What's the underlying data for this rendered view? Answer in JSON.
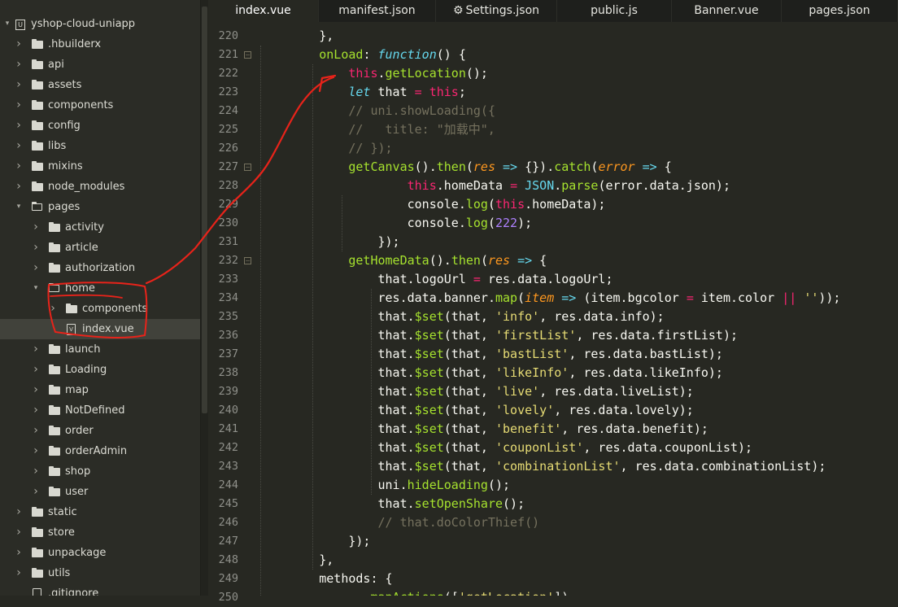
{
  "sidebar": {
    "project": "yshop-cloud-uniapp",
    "items": [
      {
        "label": ".hbuilderx",
        "type": "folder",
        "depth": 1,
        "expanded": false
      },
      {
        "label": "api",
        "type": "folder",
        "depth": 1,
        "expanded": false
      },
      {
        "label": "assets",
        "type": "folder",
        "depth": 1,
        "expanded": false
      },
      {
        "label": "components",
        "type": "folder",
        "depth": 1,
        "expanded": false
      },
      {
        "label": "config",
        "type": "folder",
        "depth": 1,
        "expanded": false
      },
      {
        "label": "libs",
        "type": "folder",
        "depth": 1,
        "expanded": false
      },
      {
        "label": "mixins",
        "type": "folder",
        "depth": 1,
        "expanded": false
      },
      {
        "label": "node_modules",
        "type": "folder",
        "depth": 1,
        "expanded": false
      },
      {
        "label": "pages",
        "type": "folder",
        "depth": 1,
        "expanded": true
      },
      {
        "label": "activity",
        "type": "folder",
        "depth": 2,
        "expanded": false
      },
      {
        "label": "article",
        "type": "folder",
        "depth": 2,
        "expanded": false
      },
      {
        "label": "authorization",
        "type": "folder",
        "depth": 2,
        "expanded": false
      },
      {
        "label": "home",
        "type": "folder",
        "depth": 2,
        "expanded": true
      },
      {
        "label": "components",
        "type": "folder",
        "depth": 3,
        "expanded": false
      },
      {
        "label": "index.vue",
        "type": "file",
        "depth": 3,
        "selected": true,
        "icon_text": "V"
      },
      {
        "label": "launch",
        "type": "folder",
        "depth": 2,
        "expanded": false
      },
      {
        "label": "Loading",
        "type": "folder",
        "depth": 2,
        "expanded": false
      },
      {
        "label": "map",
        "type": "folder",
        "depth": 2,
        "expanded": false
      },
      {
        "label": "NotDefined",
        "type": "folder",
        "depth": 2,
        "expanded": false
      },
      {
        "label": "order",
        "type": "folder",
        "depth": 2,
        "expanded": false
      },
      {
        "label": "orderAdmin",
        "type": "folder",
        "depth": 2,
        "expanded": false
      },
      {
        "label": "shop",
        "type": "folder",
        "depth": 2,
        "expanded": false
      },
      {
        "label": "user",
        "type": "folder",
        "depth": 2,
        "expanded": false
      },
      {
        "label": "static",
        "type": "folder",
        "depth": 1,
        "expanded": false
      },
      {
        "label": "store",
        "type": "folder",
        "depth": 1,
        "expanded": false
      },
      {
        "label": "unpackage",
        "type": "folder",
        "depth": 1,
        "expanded": false
      },
      {
        "label": "utils",
        "type": "folder",
        "depth": 1,
        "expanded": false
      },
      {
        "label": ".gitignore",
        "type": "file",
        "depth": 1,
        "icon_text": ""
      }
    ]
  },
  "tabs": [
    {
      "label": "index.vue",
      "active": true,
      "icon": ""
    },
    {
      "label": "manifest.json",
      "active": false,
      "icon": ""
    },
    {
      "label": "Settings.json",
      "active": false,
      "icon": "gear-icon"
    },
    {
      "label": "public.js",
      "active": false,
      "icon": ""
    },
    {
      "label": "Banner.vue",
      "active": false,
      "icon": ""
    },
    {
      "label": "pages.json",
      "active": false,
      "icon": ""
    }
  ],
  "editor": {
    "lines": [
      {
        "n": "220",
        "fold": false,
        "tokens": [
          [
            "        },",
            "t-plain"
          ]
        ]
      },
      {
        "n": "221",
        "fold": true,
        "tokens": [
          [
            "        ",
            "t-plain"
          ],
          [
            "onLoad",
            "t-fn"
          ],
          [
            ": ",
            "t-plain"
          ],
          [
            "function",
            "t-kw"
          ],
          [
            "() {",
            "t-plain"
          ]
        ]
      },
      {
        "n": "222",
        "fold": false,
        "tokens": [
          [
            "            ",
            "t-plain"
          ],
          [
            "this",
            "t-this"
          ],
          [
            ".",
            "t-plain"
          ],
          [
            "getLocation",
            "t-fn"
          ],
          [
            "();",
            "t-plain"
          ]
        ]
      },
      {
        "n": "223",
        "fold": false,
        "tokens": [
          [
            "            ",
            "t-plain"
          ],
          [
            "let",
            "t-kw"
          ],
          [
            " that ",
            "t-plain"
          ],
          [
            "=",
            "t-op"
          ],
          [
            " ",
            "t-plain"
          ],
          [
            "this",
            "t-this"
          ],
          [
            ";",
            "t-plain"
          ]
        ]
      },
      {
        "n": "224",
        "fold": false,
        "tokens": [
          [
            "            ",
            "t-plain"
          ],
          [
            "// uni.showLoading({",
            "t-cm"
          ]
        ]
      },
      {
        "n": "225",
        "fold": false,
        "tokens": [
          [
            "            ",
            "t-plain"
          ],
          [
            "//   title: \"加载中\",",
            "t-cm"
          ]
        ]
      },
      {
        "n": "226",
        "fold": false,
        "tokens": [
          [
            "            ",
            "t-plain"
          ],
          [
            "// });",
            "t-cm"
          ]
        ]
      },
      {
        "n": "227",
        "fold": true,
        "tokens": [
          [
            "            ",
            "t-plain"
          ],
          [
            "getCanvas",
            "t-fn"
          ],
          [
            "().",
            "t-plain"
          ],
          [
            "then",
            "t-fn"
          ],
          [
            "(",
            "t-plain"
          ],
          [
            "res",
            "t-param"
          ],
          [
            " ",
            "t-plain"
          ],
          [
            "=>",
            "t-kw"
          ],
          [
            " {}).",
            "t-plain"
          ],
          [
            "catch",
            "t-fn"
          ],
          [
            "(",
            "t-plain"
          ],
          [
            "error",
            "t-param"
          ],
          [
            " ",
            "t-plain"
          ],
          [
            "=>",
            "t-kw"
          ],
          [
            " {",
            "t-plain"
          ]
        ]
      },
      {
        "n": "228",
        "fold": false,
        "tokens": [
          [
            "                    ",
            "t-plain"
          ],
          [
            "this",
            "t-this"
          ],
          [
            ".homeData ",
            "t-plain"
          ],
          [
            "=",
            "t-op"
          ],
          [
            " ",
            "t-plain"
          ],
          [
            "JSON",
            "t-obj"
          ],
          [
            ".",
            "t-plain"
          ],
          [
            "parse",
            "t-fn"
          ],
          [
            "(error.data.json);",
            "t-plain"
          ]
        ]
      },
      {
        "n": "229",
        "fold": false,
        "tokens": [
          [
            "                    ",
            "t-plain"
          ],
          [
            "console",
            "t-plain"
          ],
          [
            ".",
            "t-plain"
          ],
          [
            "log",
            "t-fn"
          ],
          [
            "(",
            "t-plain"
          ],
          [
            "this",
            "t-this"
          ],
          [
            ".homeData);",
            "t-plain"
          ]
        ]
      },
      {
        "n": "230",
        "fold": false,
        "tokens": [
          [
            "                    ",
            "t-plain"
          ],
          [
            "console",
            "t-plain"
          ],
          [
            ".",
            "t-plain"
          ],
          [
            "log",
            "t-fn"
          ],
          [
            "(",
            "t-plain"
          ],
          [
            "222",
            "t-num"
          ],
          [
            ");",
            "t-plain"
          ]
        ]
      },
      {
        "n": "231",
        "fold": false,
        "tokens": [
          [
            "                ",
            "t-plain"
          ],
          [
            "});",
            "t-plain"
          ]
        ]
      },
      {
        "n": "232",
        "fold": true,
        "tokens": [
          [
            "            ",
            "t-plain"
          ],
          [
            "getHomeData",
            "t-fn"
          ],
          [
            "().",
            "t-plain"
          ],
          [
            "then",
            "t-fn"
          ],
          [
            "(",
            "t-plain"
          ],
          [
            "res",
            "t-param"
          ],
          [
            " ",
            "t-plain"
          ],
          [
            "=>",
            "t-kw"
          ],
          [
            " {",
            "t-plain"
          ]
        ]
      },
      {
        "n": "233",
        "fold": false,
        "tokens": [
          [
            "                ",
            "t-plain"
          ],
          [
            "that.logoUrl ",
            "t-plain"
          ],
          [
            "=",
            "t-op"
          ],
          [
            " res.data.logoUrl;",
            "t-plain"
          ]
        ]
      },
      {
        "n": "234",
        "fold": false,
        "tokens": [
          [
            "                ",
            "t-plain"
          ],
          [
            "res.data.banner.",
            "t-plain"
          ],
          [
            "map",
            "t-fn"
          ],
          [
            "(",
            "t-plain"
          ],
          [
            "item",
            "t-param"
          ],
          [
            " ",
            "t-plain"
          ],
          [
            "=>",
            "t-kw"
          ],
          [
            " (item.bgcolor ",
            "t-plain"
          ],
          [
            "=",
            "t-op"
          ],
          [
            " item.color ",
            "t-plain"
          ],
          [
            "||",
            "t-op"
          ],
          [
            " ",
            "t-plain"
          ],
          [
            "''",
            "t-str"
          ],
          [
            "));",
            "t-plain"
          ]
        ]
      },
      {
        "n": "235",
        "fold": false,
        "tokens": [
          [
            "                ",
            "t-plain"
          ],
          [
            "that.",
            "t-plain"
          ],
          [
            "$set",
            "t-fn"
          ],
          [
            "(that, ",
            "t-plain"
          ],
          [
            "'info'",
            "t-str"
          ],
          [
            ", res.data.info);",
            "t-plain"
          ]
        ]
      },
      {
        "n": "236",
        "fold": false,
        "tokens": [
          [
            "                ",
            "t-plain"
          ],
          [
            "that.",
            "t-plain"
          ],
          [
            "$set",
            "t-fn"
          ],
          [
            "(that, ",
            "t-plain"
          ],
          [
            "'firstList'",
            "t-str"
          ],
          [
            ", res.data.firstList);",
            "t-plain"
          ]
        ]
      },
      {
        "n": "237",
        "fold": false,
        "tokens": [
          [
            "                ",
            "t-plain"
          ],
          [
            "that.",
            "t-plain"
          ],
          [
            "$set",
            "t-fn"
          ],
          [
            "(that, ",
            "t-plain"
          ],
          [
            "'bastList'",
            "t-str"
          ],
          [
            ", res.data.bastList);",
            "t-plain"
          ]
        ]
      },
      {
        "n": "238",
        "fold": false,
        "tokens": [
          [
            "                ",
            "t-plain"
          ],
          [
            "that.",
            "t-plain"
          ],
          [
            "$set",
            "t-fn"
          ],
          [
            "(that, ",
            "t-plain"
          ],
          [
            "'likeInfo'",
            "t-str"
          ],
          [
            ", res.data.likeInfo);",
            "t-plain"
          ]
        ]
      },
      {
        "n": "239",
        "fold": false,
        "tokens": [
          [
            "                ",
            "t-plain"
          ],
          [
            "that.",
            "t-plain"
          ],
          [
            "$set",
            "t-fn"
          ],
          [
            "(that, ",
            "t-plain"
          ],
          [
            "'live'",
            "t-str"
          ],
          [
            ", res.data.liveList);",
            "t-plain"
          ]
        ]
      },
      {
        "n": "240",
        "fold": false,
        "tokens": [
          [
            "                ",
            "t-plain"
          ],
          [
            "that.",
            "t-plain"
          ],
          [
            "$set",
            "t-fn"
          ],
          [
            "(that, ",
            "t-plain"
          ],
          [
            "'lovely'",
            "t-str"
          ],
          [
            ", res.data.lovely);",
            "t-plain"
          ]
        ]
      },
      {
        "n": "241",
        "fold": false,
        "tokens": [
          [
            "                ",
            "t-plain"
          ],
          [
            "that.",
            "t-plain"
          ],
          [
            "$set",
            "t-fn"
          ],
          [
            "(that, ",
            "t-plain"
          ],
          [
            "'benefit'",
            "t-str"
          ],
          [
            ", res.data.benefit);",
            "t-plain"
          ]
        ]
      },
      {
        "n": "242",
        "fold": false,
        "tokens": [
          [
            "                ",
            "t-plain"
          ],
          [
            "that.",
            "t-plain"
          ],
          [
            "$set",
            "t-fn"
          ],
          [
            "(that, ",
            "t-plain"
          ],
          [
            "'couponList'",
            "t-str"
          ],
          [
            ", res.data.couponList);",
            "t-plain"
          ]
        ]
      },
      {
        "n": "243",
        "fold": false,
        "tokens": [
          [
            "                ",
            "t-plain"
          ],
          [
            "that.",
            "t-plain"
          ],
          [
            "$set",
            "t-fn"
          ],
          [
            "(that, ",
            "t-plain"
          ],
          [
            "'combinationList'",
            "t-str"
          ],
          [
            ", res.data.combinationList);",
            "t-plain"
          ]
        ]
      },
      {
        "n": "244",
        "fold": false,
        "tokens": [
          [
            "                ",
            "t-plain"
          ],
          [
            "uni.",
            "t-plain"
          ],
          [
            "hideLoading",
            "t-fn"
          ],
          [
            "();",
            "t-plain"
          ]
        ]
      },
      {
        "n": "245",
        "fold": false,
        "tokens": [
          [
            "                ",
            "t-plain"
          ],
          [
            "that.",
            "t-plain"
          ],
          [
            "setOpenShare",
            "t-fn"
          ],
          [
            "();",
            "t-plain"
          ]
        ]
      },
      {
        "n": "246",
        "fold": false,
        "tokens": [
          [
            "                ",
            "t-plain"
          ],
          [
            "// that.doColorThief()",
            "t-cm"
          ]
        ]
      },
      {
        "n": "247",
        "fold": false,
        "tokens": [
          [
            "            ",
            "t-plain"
          ],
          [
            "});",
            "t-plain"
          ]
        ]
      },
      {
        "n": "248",
        "fold": false,
        "tokens": [
          [
            "        ",
            "t-plain"
          ],
          [
            "},",
            "t-plain"
          ]
        ]
      },
      {
        "n": "249",
        "fold": false,
        "tokens": [
          [
            "        ",
            "t-plain"
          ],
          [
            "methods: {",
            "t-plain"
          ]
        ]
      },
      {
        "n": "250",
        "fold": false,
        "tokens": [
          [
            "            ",
            "t-plain"
          ],
          [
            "...",
            "t-plain"
          ],
          [
            "mapActions",
            "t-fn"
          ],
          [
            "([",
            "t-plain"
          ],
          [
            "'getLocation'",
            "t-str"
          ],
          [
            "]),",
            "t-plain"
          ]
        ]
      }
    ]
  },
  "colors": {
    "annotation": "#e8231a",
    "background": "#272822"
  }
}
